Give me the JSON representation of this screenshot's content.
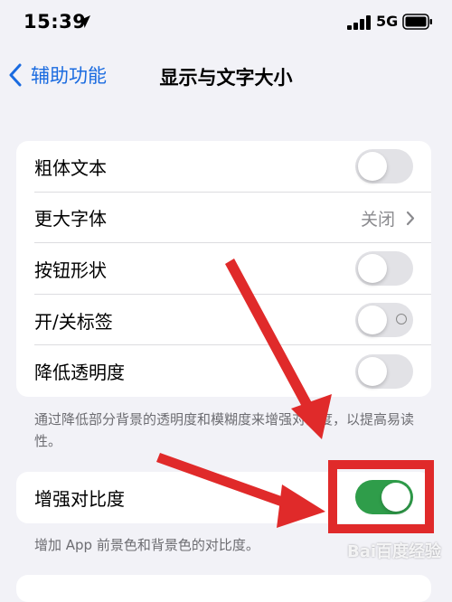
{
  "status_bar": {
    "time": "15:39",
    "network": "5G",
    "icons": [
      "location-arrow-icon",
      "signal-bars-icon",
      "battery-icon"
    ]
  },
  "navbar": {
    "back_label": "辅助功能",
    "title": "显示与文字大小"
  },
  "settings_group": {
    "rows": [
      {
        "label": "粗体文本",
        "control": "toggle",
        "state": "off"
      },
      {
        "label": "更大字体",
        "control": "disclosure",
        "value": "关闭"
      },
      {
        "label": "按钮形状",
        "control": "toggle",
        "state": "off"
      },
      {
        "label": "开/关标签",
        "control": "toggle",
        "state": "off"
      },
      {
        "label": "降低透明度",
        "control": "toggle",
        "state": "off"
      }
    ],
    "footer": "通过降低部分背景的透明度和模糊度来增强对比度，以提高易读性。"
  },
  "contrast_group": {
    "rows": [
      {
        "label": "增强对比度",
        "control": "toggle",
        "state": "on"
      }
    ],
    "footer": "增加 App 前景色和背景色的对比度。"
  },
  "annotations": {
    "arrow_color": "#e02a2a",
    "highlight_color": "#e02a2a"
  },
  "watermark": "Bai百度经验",
  "colors": {
    "accent": "#1a6be0",
    "toggle_on": "#2f9d4a",
    "toggle_off": "#e2e2e6",
    "background": "#f2f2f7"
  }
}
